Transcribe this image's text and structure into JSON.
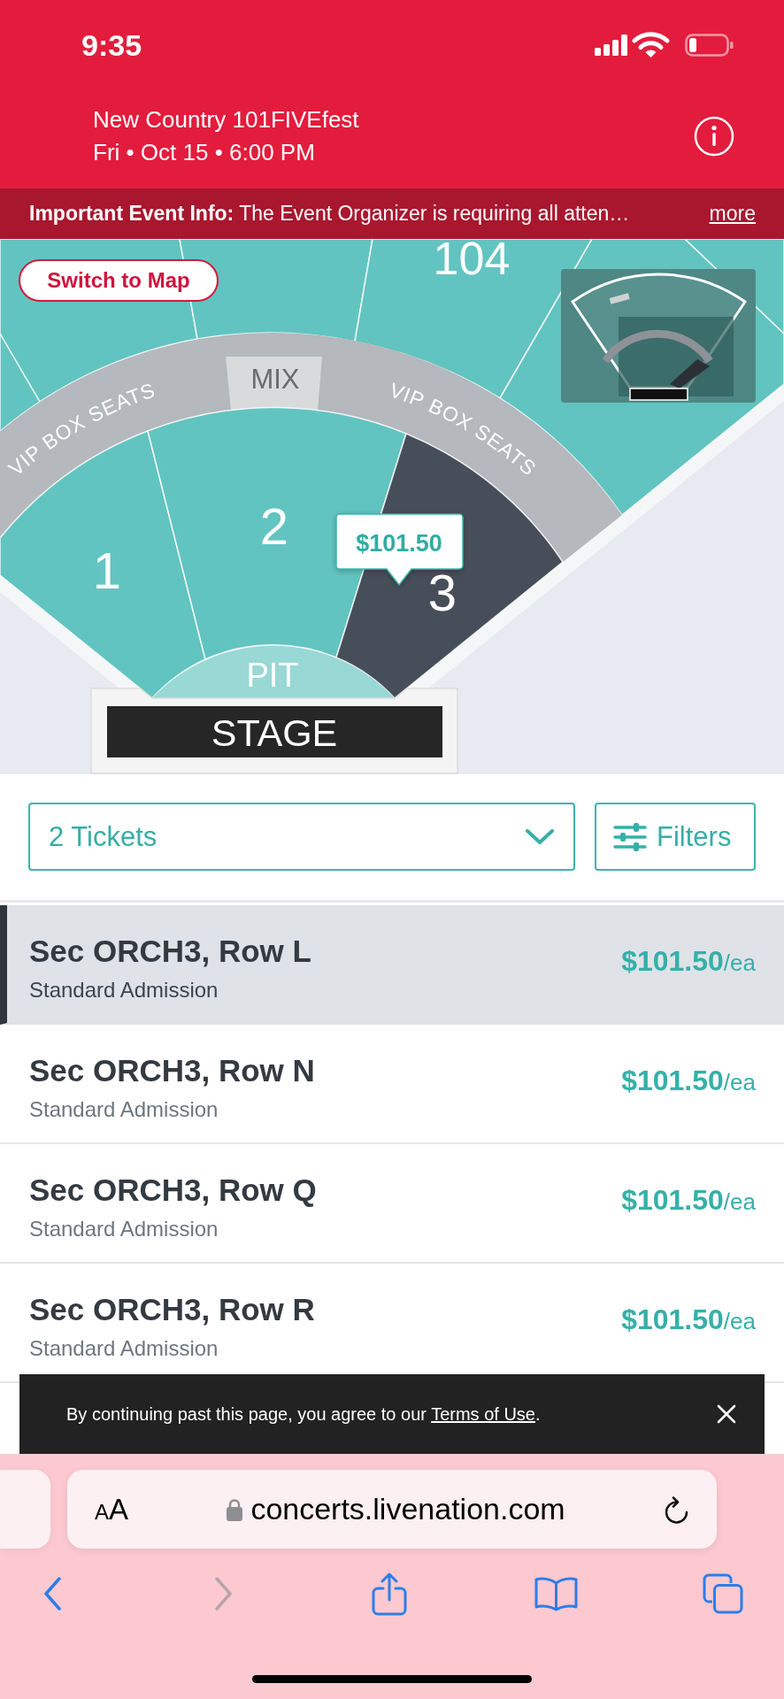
{
  "status_bar": {
    "time": "9:35"
  },
  "event": {
    "title": "New Country 101FIVEfest",
    "date": "Fri • Oct 15 • 6:00 PM"
  },
  "info_banner": {
    "text": "**Important Event Info:** The Event Organizer is requiring all atten…",
    "link": "more"
  },
  "seat_map": {
    "switch_button": "Switch to Map",
    "upper_section_label": "104",
    "vip_labels": [
      "VIP BOX SEATS",
      "VIP BOX SEATS"
    ],
    "mix_label": "MIX",
    "sections": [
      {
        "label": "1",
        "selected": false
      },
      {
        "label": "2",
        "selected": false
      },
      {
        "label": "3",
        "selected": true
      }
    ],
    "pit_label": "PIT",
    "stage_label": "STAGE",
    "price_tooltip": "$101.50"
  },
  "controls": {
    "ticket_quantity": {
      "value": "2 Tickets"
    },
    "filters_button": "Filters"
  },
  "listings": [
    {
      "title": "Sec ORCH3, Row L",
      "subtitle": "Standard Admission",
      "price": "$101.50",
      "unit": "/ea",
      "selected": true
    },
    {
      "title": "Sec ORCH3, Row N",
      "subtitle": "Standard Admission",
      "price": "$101.50",
      "unit": "/ea",
      "selected": false
    },
    {
      "title": "Sec ORCH3, Row Q",
      "subtitle": "Standard Admission",
      "price": "$101.50",
      "unit": "/ea",
      "selected": false
    },
    {
      "title": "Sec ORCH3, Row R",
      "subtitle": "Standard Admission",
      "price": "$101.50",
      "unit": "/ea",
      "selected": false
    }
  ],
  "cookie_notice": {
    "text_before": "By continuing past this page, you agree to our ",
    "link": "Terms of Use",
    "text_after": "."
  },
  "browser": {
    "text_size_button": "AA",
    "url": "concerts.livenation.com",
    "toolbar": [
      {
        "kind": "back",
        "disabled": false
      },
      {
        "kind": "forward",
        "disabled": true
      },
      {
        "kind": "share",
        "disabled": false
      },
      {
        "kind": "bookmarks",
        "disabled": false
      },
      {
        "kind": "tabs",
        "disabled": false
      }
    ]
  }
}
